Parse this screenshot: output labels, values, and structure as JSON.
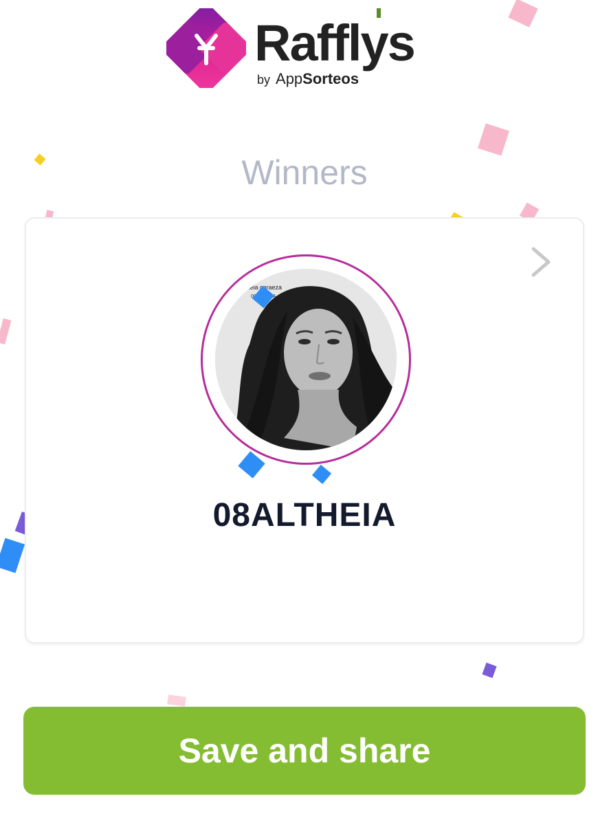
{
  "app": {
    "name": "Rafflys",
    "by_prefix": "by",
    "by_brand_regular": "App",
    "by_brand_bold": "Sorteos"
  },
  "page_title": "Winners",
  "winner": {
    "username": "08ALTHEIA",
    "avatar_caption_line1": "altheia caraeza",
    "avatar_caption_line2": "08ALTHEIA"
  },
  "actions": {
    "save_share_label": "Save and share"
  },
  "icons": {
    "next": "chevron-right-icon",
    "logo": "rafflys-logo-icon"
  },
  "colors": {
    "button": "#84bd32",
    "avatar_ring": "#b62c9c",
    "title": "#b3b8c8",
    "winner_name": "#141a2e",
    "logo_magenta": "#c41d9a",
    "logo_purple": "#7b1fa2"
  }
}
